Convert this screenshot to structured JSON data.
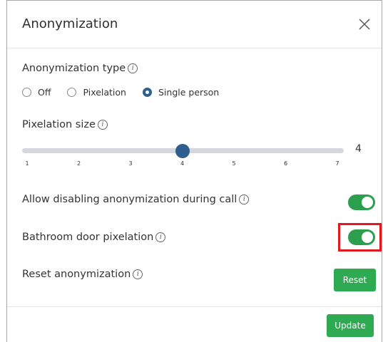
{
  "dialog": {
    "title": "Anonymization",
    "close_icon": "close-icon"
  },
  "anonymization_type": {
    "label": "Anonymization type",
    "options": [
      {
        "label": "Off",
        "selected": false
      },
      {
        "label": "Pixelation",
        "selected": false
      },
      {
        "label": "Single person",
        "selected": true
      }
    ]
  },
  "pixelation_size": {
    "label": "Pixelation size",
    "value": 4,
    "min": 1,
    "max": 7,
    "value_text": "4",
    "ticks": [
      "1",
      "2",
      "3",
      "4",
      "5",
      "6",
      "7"
    ]
  },
  "allow_disabling": {
    "label": "Allow disabling anonymization during call",
    "enabled": true
  },
  "bathroom_door": {
    "label": "Bathroom door pixelation",
    "enabled": true
  },
  "reset": {
    "label": "Reset anonymization",
    "button": "Reset"
  },
  "footer": {
    "update_button": "Update"
  },
  "info_glyph": "i",
  "colors": {
    "accent_blue": "#2f5f8f",
    "toggle_green": "#2c9f4f",
    "button_green": "#2eaa52",
    "highlight_red": "#e0181f"
  }
}
